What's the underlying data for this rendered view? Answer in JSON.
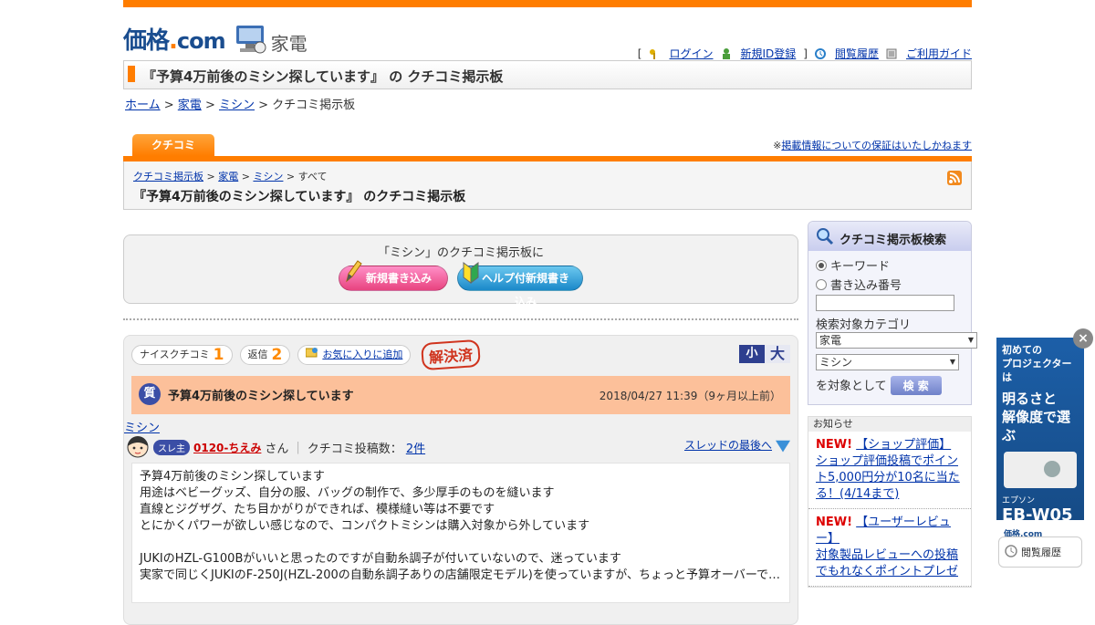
{
  "header": {
    "logo_main": "価格",
    "logo_dot": ".",
    "logo_com": "com",
    "category": "家電",
    "nav": {
      "open_bracket": "[",
      "close_bracket": "]",
      "login": "ログイン",
      "register": "新規ID登録",
      "history": "閲覧履歴",
      "guide": "ご利用ガイド"
    }
  },
  "page_title": "『予算4万前後のミシン探しています』 の クチコミ掲示板",
  "breadcrumb": {
    "home": "ホーム",
    "sep": " > ",
    "kaden": "家電",
    "mishin": "ミシン",
    "current": "クチコミ掲示板"
  },
  "tab": {
    "label": "クチコミ",
    "disclaimer_prefix": "※",
    "disclaimer_link": "掲載情報についての保証はいたしかねます"
  },
  "bbs_head": {
    "crumb_bbs": "クチコミ掲示板",
    "crumb_kaden": "家電",
    "crumb_mishin": "ミシン",
    "crumb_all": "すべて",
    "sep": " > ",
    "title": "『予算4万前後のミシン探しています』 のクチコミ掲示板"
  },
  "post_box": {
    "lead": "「ミシン」のクチコミ掲示板に",
    "new_post": "新規書き込み",
    "help_post": "ヘルプ付新規書き込み"
  },
  "thread": {
    "nice_label": "ナイスクチコミ",
    "nice_count": "1",
    "reply_label": "返信",
    "reply_count": "2",
    "favorite": "お気に入りに追加",
    "solved": "解決済",
    "size_small": "小",
    "size_large": "大",
    "q_mark": "質",
    "title": "予算4万前後のミシン探しています",
    "date": "2018/04/27 11:39（9ヶ月以上前）",
    "category_link": "ミシン",
    "owner_badge": "スレ主",
    "author": "0120-ちえみ",
    "author_suffix": "さん",
    "posts_label": "クチコミ投稿数：",
    "posts_count": "2件",
    "to_last": "スレッドの最後へ",
    "body": [
      "予算4万前後のミシン探しています",
      "用途はベビーグッズ、自分の服、バッグの制作で、多少厚手のものを縫います",
      "直線とジグザグ、たち目かがりができれば、模様縫い等は不要です",
      "とにかくパワーが欲しい感じなので、コンパクトミシンは購入対象から外しています",
      "",
      "JUKIのHZL-G100Bがいいと思ったのですが自動糸調子が付いていないので、迷っています",
      "実家で同じくJUKIのF-250J(HZL-200の自動糸調子ありの店舗限定モデル)を使っていますが、ちょっと予算オーバーで…"
    ]
  },
  "search": {
    "title": "クチコミ掲示板検索",
    "opt_keyword": "キーワード",
    "opt_number": "書き込み番号",
    "input_value": "",
    "category_label": "検索対象カテゴリ",
    "cat1": "家電",
    "cat2": "ミシン",
    "target_suffix": "を対象として",
    "button": "検 索"
  },
  "news": {
    "header": "お知らせ",
    "items": [
      {
        "new": "NEW!",
        "title": "【ショップ評価】",
        "text": "ショップ評価投稿でポイント5,000円分が10名に当たる！(4/14まで)"
      },
      {
        "new": "NEW!",
        "title": "【ユーザーレビュー】",
        "text": "対象製品レビューへの投稿でもれなくポイントプレゼ"
      }
    ]
  },
  "ad": {
    "line1": "初めての\nプロジェクターは",
    "line2": "明るさと\n解像度で選ぶ",
    "brand": "エプソン",
    "model": "EB-W05",
    "site": "価格.com",
    "close": "×"
  },
  "history_btn": "閲覧履歴"
}
